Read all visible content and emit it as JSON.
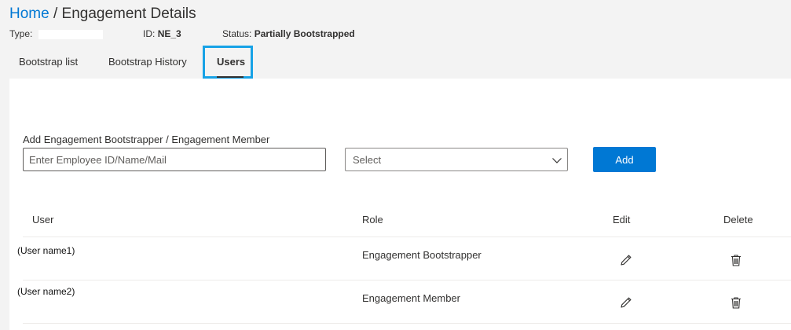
{
  "breadcrumb": {
    "home": "Home",
    "separator": "/",
    "current": "Engagement Details"
  },
  "meta": {
    "type_label": "Type:",
    "id_label": "ID:",
    "id_value": "NE_3",
    "status_label": "Status:",
    "status_value": "Partially Bootstrapped"
  },
  "tabs": [
    {
      "label": "Bootstrap list"
    },
    {
      "label": "Bootstrap History"
    },
    {
      "label": "Users",
      "active": true
    }
  ],
  "add_form": {
    "label": "Add Engagement Bootstrapper / Engagement Member",
    "input_placeholder": "Enter Employee ID/Name/Mail",
    "select_value": "Select",
    "add_label": "Add"
  },
  "table": {
    "headers": {
      "user": "User",
      "role": "Role",
      "edit": "Edit",
      "delete": "Delete"
    },
    "rows": [
      {
        "user": "(User name1)",
        "role": "Engagement Bootstrapper"
      },
      {
        "user": "(User name2)",
        "role": "Engagement Member"
      }
    ]
  },
  "colors": {
    "accent": "#0078d4",
    "focus_outline": "#17a2e6",
    "background": "#f3f3f3",
    "panel": "#ffffff"
  },
  "icons": {
    "edit": "pencil-icon",
    "delete": "trash-icon",
    "dropdown": "chevron-down-icon"
  }
}
